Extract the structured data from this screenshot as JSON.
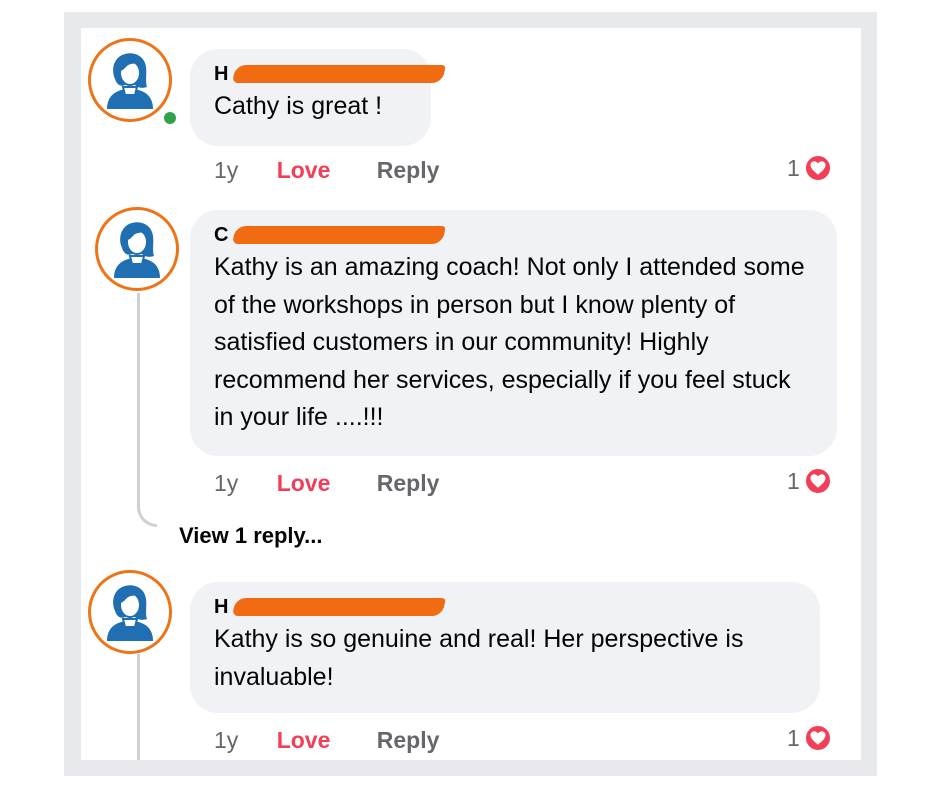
{
  "comments": [
    {
      "author": "H",
      "text": "Cathy is great !",
      "time": "1y",
      "love_label": "Love",
      "reply_label": "Reply",
      "reaction_count": "1",
      "online": true
    },
    {
      "author": "C",
      "text": "Kathy is an amazing coach! Not only I attended some of the workshops in person but I know plenty of satisfied customers in our community! Highly recommend her services, especially if you feel stuck in your life ....!!!",
      "time": "1y",
      "love_label": "Love",
      "reply_label": "Reply",
      "reaction_count": "1",
      "view_replies": "View 1 reply..."
    },
    {
      "author": "H",
      "text": "Kathy is so genuine and real! Her perspective is invaluable!",
      "time": "1y",
      "love_label": "Love",
      "reply_label": "Reply",
      "reaction_count": "1"
    }
  ],
  "icons": {
    "avatar": "person-avatar-icon",
    "reaction": "heart-icon",
    "redaction": "redaction-mark"
  },
  "colors": {
    "avatar_ring": "#ee7418",
    "avatar_figure": "#1f6fb2",
    "love": "#f33e58",
    "bubble": "#f0f2f5",
    "redaction": "#f06b12",
    "online": "#31a24c"
  }
}
